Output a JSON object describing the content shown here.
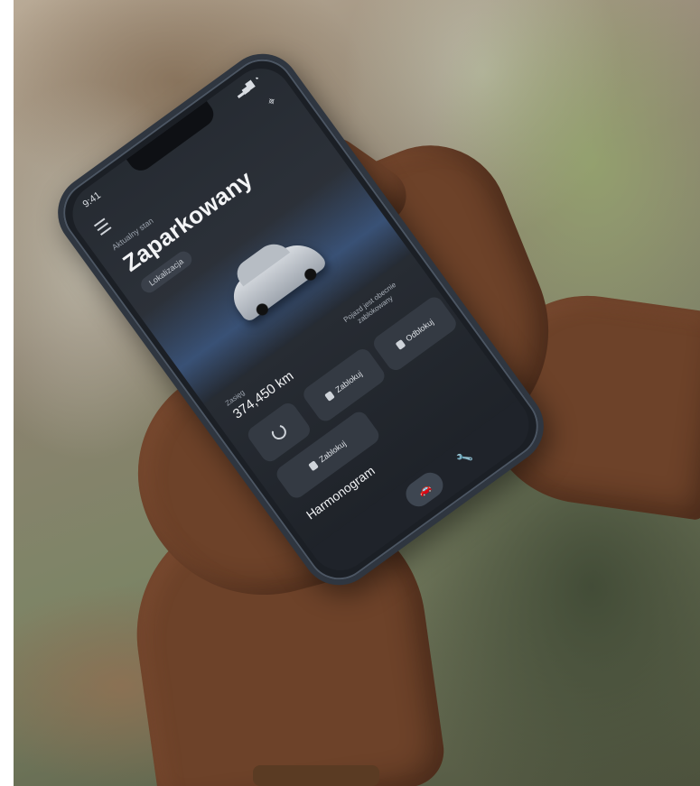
{
  "phone_app": {
    "status_time": "9:41",
    "status_icons": "▂▄▆ ◔",
    "subtitle": "Aktualny stan",
    "title": "Zaparkowany",
    "location_chip": "Lokalizacja",
    "range_label": "Zasięg",
    "range_value": "374,450 km",
    "range_desc": "Pojazd jest obecnie zablokowany",
    "tiles": {
      "power": "",
      "lock1": "Zablokuj",
      "lock2": "Odblokuj",
      "lock3": "Zablokuj"
    },
    "schedule_label": "Harmonogram",
    "nav_car_icon": "🚗",
    "nav_wrench_icon": "🔧"
  },
  "colors": {
    "screen_bg": "#262b32",
    "accent_glow": "#466eaa",
    "skin": "#6d4229"
  }
}
